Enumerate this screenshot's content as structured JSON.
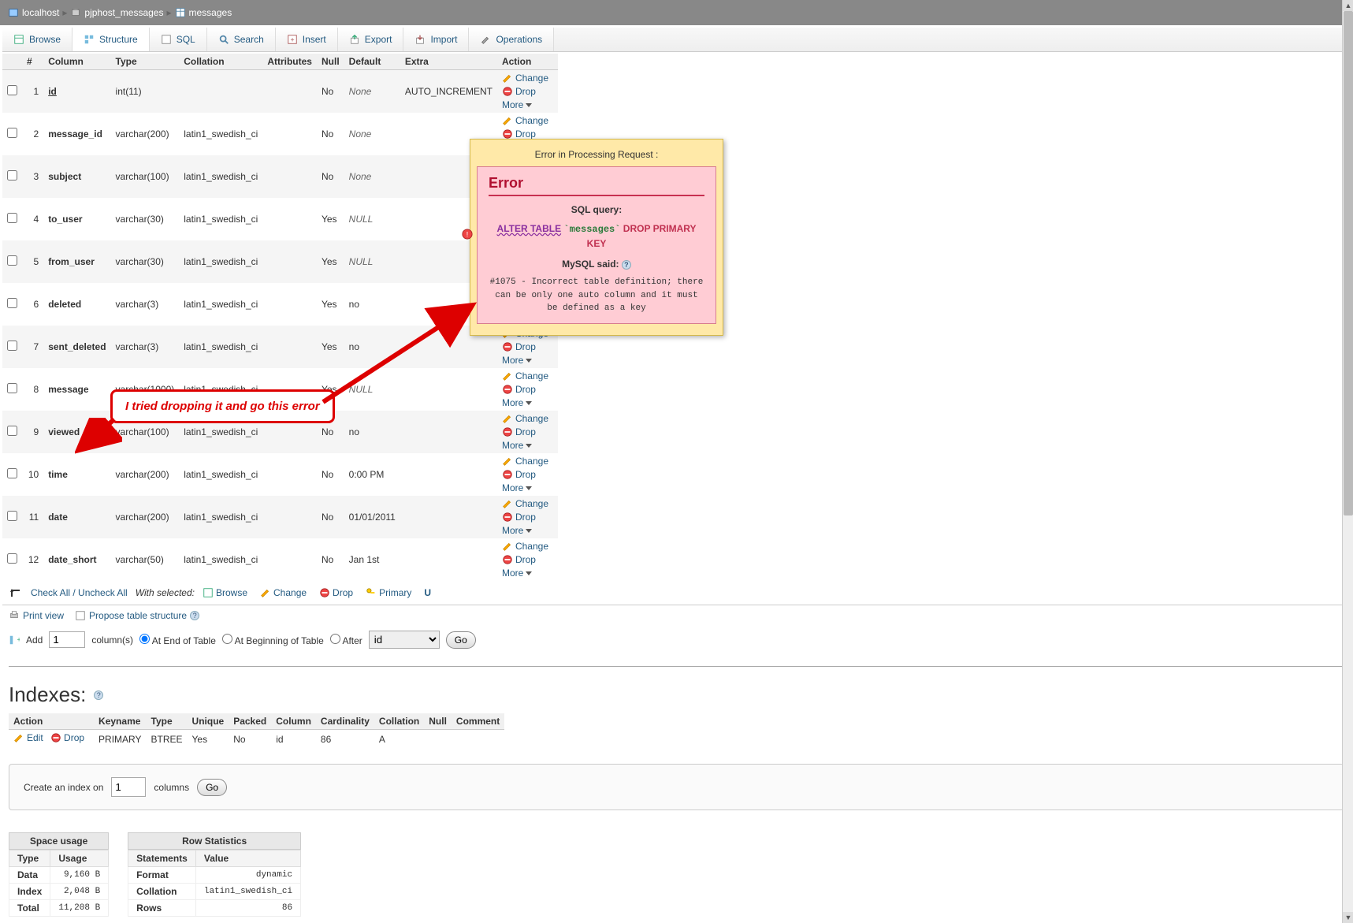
{
  "breadcrumb": {
    "server": "localhost",
    "db": "pjphost_messages",
    "table": "messages"
  },
  "tabs": {
    "browse": "Browse",
    "structure": "Structure",
    "sql": "SQL",
    "search": "Search",
    "insert": "Insert",
    "export": "Export",
    "import": "Import",
    "operations": "Operations"
  },
  "struct_headers": {
    "num": "#",
    "column": "Column",
    "type": "Type",
    "collation": "Collation",
    "attributes": "Attributes",
    "null": "Null",
    "default": "Default",
    "extra": "Extra",
    "action": "Action"
  },
  "columns": [
    {
      "n": "1",
      "name": "id",
      "type": "int(11)",
      "coll": "",
      "null": "No",
      "def": "None",
      "def_italic": true,
      "extra": "AUTO_INCREMENT",
      "underline": true
    },
    {
      "n": "2",
      "name": "message_id",
      "type": "varchar(200)",
      "coll": "latin1_swedish_ci",
      "null": "No",
      "def": "None",
      "def_italic": true,
      "extra": ""
    },
    {
      "n": "3",
      "name": "subject",
      "type": "varchar(100)",
      "coll": "latin1_swedish_ci",
      "null": "No",
      "def": "None",
      "def_italic": true,
      "extra": ""
    },
    {
      "n": "4",
      "name": "to_user",
      "type": "varchar(30)",
      "coll": "latin1_swedish_ci",
      "null": "Yes",
      "def": "NULL",
      "def_italic": true,
      "extra": ""
    },
    {
      "n": "5",
      "name": "from_user",
      "type": "varchar(30)",
      "coll": "latin1_swedish_ci",
      "null": "Yes",
      "def": "NULL",
      "def_italic": true,
      "extra": ""
    },
    {
      "n": "6",
      "name": "deleted",
      "type": "varchar(3)",
      "coll": "latin1_swedish_ci",
      "null": "Yes",
      "def": "no",
      "def_italic": false,
      "extra": ""
    },
    {
      "n": "7",
      "name": "sent_deleted",
      "type": "varchar(3)",
      "coll": "latin1_swedish_ci",
      "null": "Yes",
      "def": "no",
      "def_italic": false,
      "extra": ""
    },
    {
      "n": "8",
      "name": "message",
      "type": "varchar(1000)",
      "coll": "latin1_swedish_ci",
      "null": "Yes",
      "def": "NULL",
      "def_italic": true,
      "extra": ""
    },
    {
      "n": "9",
      "name": "viewed",
      "type": "varchar(100)",
      "coll": "latin1_swedish_ci",
      "null": "No",
      "def": "no",
      "def_italic": false,
      "extra": ""
    },
    {
      "n": "10",
      "name": "time",
      "type": "varchar(200)",
      "coll": "latin1_swedish_ci",
      "null": "No",
      "def": "0:00 PM",
      "def_italic": false,
      "extra": ""
    },
    {
      "n": "11",
      "name": "date",
      "type": "varchar(200)",
      "coll": "latin1_swedish_ci",
      "null": "No",
      "def": "01/01/2011",
      "def_italic": false,
      "extra": ""
    },
    {
      "n": "12",
      "name": "date_short",
      "type": "varchar(50)",
      "coll": "latin1_swedish_ci",
      "null": "No",
      "def": "Jan 1st",
      "def_italic": false,
      "extra": ""
    }
  ],
  "action_labels": {
    "change": "Change",
    "drop": "Drop",
    "more": "More"
  },
  "tools": {
    "check_all": "Check All / Uncheck All",
    "with_selected": "With selected:",
    "browse": "Browse",
    "change": "Change",
    "drop": "Drop",
    "primary": "Primary",
    "unique_partial": "U"
  },
  "print_row": {
    "print_view": "Print view",
    "propose": "Propose table structure"
  },
  "add_row": {
    "add": "Add",
    "count": "1",
    "columns": "column(s)",
    "at_end": "At End of Table",
    "at_begin": "At Beginning of Table",
    "after": "After",
    "after_col": "id",
    "go": "Go"
  },
  "indexes": {
    "title": "Indexes:",
    "headers": {
      "action": "Action",
      "keyname": "Keyname",
      "type": "Type",
      "unique": "Unique",
      "packed": "Packed",
      "column": "Column",
      "cardinality": "Cardinality",
      "collation": "Collation",
      "null": "Null",
      "comment": "Comment"
    },
    "row": {
      "edit": "Edit",
      "drop": "Drop",
      "keyname": "PRIMARY",
      "type": "BTREE",
      "unique": "Yes",
      "packed": "No",
      "column": "id",
      "cardinality": "86",
      "collation": "A",
      "null": "",
      "comment": ""
    }
  },
  "create_index": {
    "pre": "Create an index on",
    "count": "1",
    "post": "columns",
    "go": "Go"
  },
  "space": {
    "caption": "Space usage",
    "h_type": "Type",
    "h_usage": "Usage",
    "rows": [
      {
        "t": "Data",
        "v": "9,160",
        "u": "B"
      },
      {
        "t": "Index",
        "v": "2,048",
        "u": "B"
      },
      {
        "t": "Total",
        "v": "11,208",
        "u": "B"
      }
    ]
  },
  "rowstats": {
    "caption": "Row Statistics",
    "h_stmt": "Statements",
    "h_val": "Value",
    "rows": [
      {
        "s": "Format",
        "v": "dynamic"
      },
      {
        "s": "Collation",
        "v": "latin1_swedish_ci"
      },
      {
        "s": "Rows",
        "v": "86"
      }
    ]
  },
  "popup": {
    "title": "Error in Processing Request :",
    "heading": "Error",
    "sql_query_label": "SQL query:",
    "alter": "ALTER TABLE",
    "tbl": "`messages`",
    "drop_pk": "DROP PRIMARY KEY",
    "mysql_said": "MySQL said:",
    "err": "#1075 - Incorrect table definition; there can be only one auto column and it must be defined as a key"
  },
  "callout": "I tried dropping it and go this error"
}
